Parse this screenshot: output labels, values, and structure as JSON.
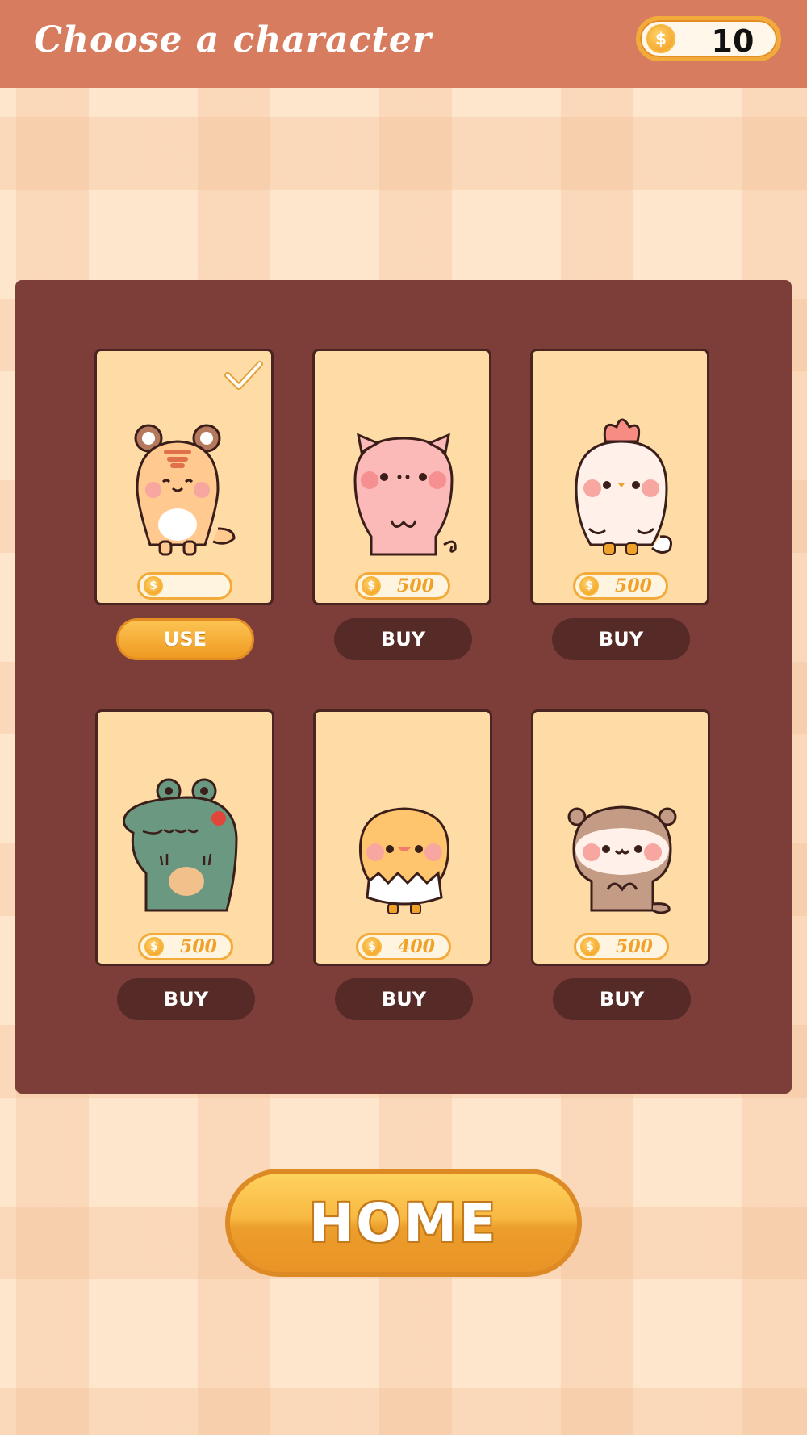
{
  "header": {
    "title": "Choose a character",
    "coin_icon": "coin-icon",
    "coin_symbol": "$",
    "coins": "10"
  },
  "colors": {
    "header": "#d87c60",
    "panel": "#7d3e3a",
    "card": "#ffdca6",
    "buy_button": "#562b27",
    "use_button": "#f4a62e"
  },
  "characters": [
    {
      "animal": "tiger",
      "price": "",
      "action": "USE",
      "selected": true
    },
    {
      "animal": "pig",
      "price": "500",
      "action": "BUY",
      "selected": false
    },
    {
      "animal": "chicken",
      "price": "500",
      "action": "BUY",
      "selected": false
    },
    {
      "animal": "crocodile",
      "price": "500",
      "action": "BUY",
      "selected": false
    },
    {
      "animal": "chick",
      "price": "400",
      "action": "BUY",
      "selected": false
    },
    {
      "animal": "otter",
      "price": "500",
      "action": "BUY",
      "selected": false
    }
  ],
  "home_button": {
    "label": "HOME"
  }
}
